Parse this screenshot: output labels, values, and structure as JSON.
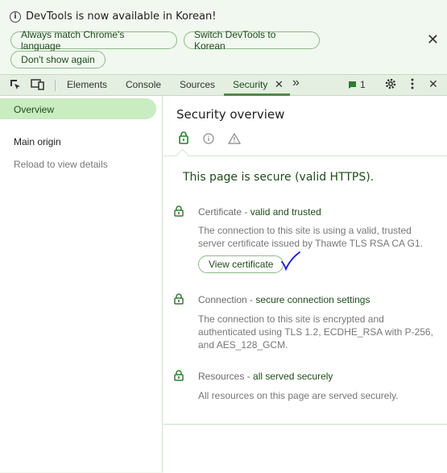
{
  "infobar": {
    "message": "DevTools is now available in Korean!",
    "buttons": [
      "Always match Chrome's language",
      "Switch DevTools to Korean",
      "Don't show again"
    ],
    "close": "✕"
  },
  "toolbar": {
    "tabs": [
      "Elements",
      "Console",
      "Sources",
      "Security"
    ],
    "tab_close": "✕",
    "more": "»",
    "issues_count": "1"
  },
  "sidebar": {
    "overview": "Overview",
    "main_origin": "Main origin",
    "reload": "Reload to view details"
  },
  "main": {
    "title": "Security overview",
    "heading": "This page is secure (valid HTTPS).",
    "sections": [
      {
        "label": "Certificate",
        "sep": " - ",
        "status": "valid and trusted",
        "desc": "The connection to this site is using a valid, trusted server certificate issued by Thawte TLS RSA CA G1."
      },
      {
        "label": "Connection",
        "sep": " - ",
        "status": "secure connection settings",
        "desc": "The connection to this site is encrypted and authenticated using TLS 1.2, ECDHE_RSA with P-256, and AES_128_GCM."
      },
      {
        "label": "Resources",
        "sep": " - ",
        "status": "all served securely",
        "desc": "All resources on this page are served securely."
      }
    ],
    "view_certificate": "View certificate"
  },
  "colors": {
    "accent": "#1e4d1b",
    "active_bg": "#c9ecc1",
    "annotation": "#1a1adb"
  }
}
